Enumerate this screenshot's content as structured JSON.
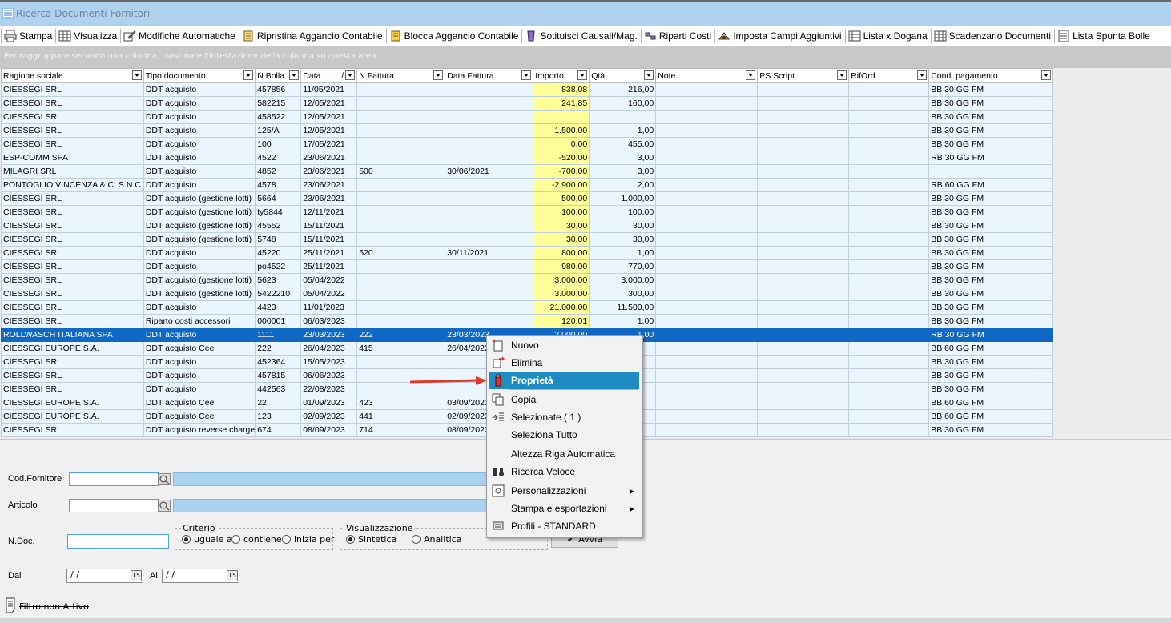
{
  "window": {
    "title": "Ricerca Documenti Fornitori"
  },
  "toolbar": [
    {
      "label": "Stampa",
      "icon": "print-icon"
    },
    {
      "label": "Visualizza",
      "icon": "grid-icon"
    },
    {
      "label": "Modifiche Automatiche",
      "icon": "edit-icon"
    },
    {
      "label": "Ripristina Aggancio Contabile",
      "icon": "restore-icon"
    },
    {
      "label": "Blocca Aggancio Contabile",
      "icon": "lock-icon"
    },
    {
      "label": "Sotituisci Causali/Mag.",
      "icon": "replace-icon"
    },
    {
      "label": "Riparti Costi",
      "icon": "split-icon"
    },
    {
      "label": "Imposta Campi Aggiuntivi",
      "icon": "settings-icon"
    },
    {
      "label": "Lista x Dogana",
      "icon": "list-icon"
    },
    {
      "label": "Scadenzario Documenti",
      "icon": "calendar-icon"
    },
    {
      "label": "Lista Spunta Bolle",
      "icon": "checklist-icon"
    }
  ],
  "group_hint": "Per raggruppare secondo una colonna, trascinare l'intestazione della colonna su questa area",
  "grid": {
    "columns": [
      "Ragione sociale",
      "Tipo documento",
      "N.Bolla",
      "Data ...",
      "N.Fattura",
      "Data Fattura",
      "Importo",
      "Qtà",
      "Note",
      "PS.Script",
      "RifOrd.",
      "Cond. pagamento"
    ],
    "sort_indicator": "/",
    "rows": [
      [
        "CIESSEGI SRL",
        "DDT acquisto",
        "457856",
        "11/05/2021",
        "",
        "",
        "838,08",
        "216,00",
        "",
        "",
        "",
        "BB 30 GG FM"
      ],
      [
        "CIESSEGI SRL",
        "DDT acquisto",
        "582215",
        "12/05/2021",
        "",
        "",
        "241,85",
        "160,00",
        "",
        "",
        "",
        "BB 30 GG FM"
      ],
      [
        "CIESSEGI SRL",
        "DDT acquisto",
        "458522",
        "12/05/2021",
        "",
        "",
        "",
        "",
        "",
        "",
        "",
        "BB 30 GG FM"
      ],
      [
        "CIESSEGI SRL",
        "DDT acquisto",
        "125/A",
        "12/05/2021",
        "",
        "",
        "1.500,00",
        "1,00",
        "",
        "",
        "",
        "BB 30 GG FM"
      ],
      [
        "CIESSEGI SRL",
        "DDT acquisto",
        "100",
        "17/05/2021",
        "",
        "",
        "0,00",
        "455,00",
        "",
        "",
        "",
        "BB 30 GG FM"
      ],
      [
        "ESP-COMM SPA",
        "DDT acquisto",
        "4522",
        "23/06/2021",
        "",
        "",
        "-520,00",
        "3,00",
        "",
        "",
        "",
        "RB 30 GG FM"
      ],
      [
        "MILAGRI SRL",
        "DDT acquisto",
        "4852",
        "23/06/2021",
        "500",
        "30/06/2021",
        "-700,00",
        "3,00",
        "",
        "",
        "",
        ""
      ],
      [
        "PONTOGLIO VINCENZA & C. S.N.C.",
        "DDT acquisto",
        "4578",
        "23/06/2021",
        "",
        "",
        "-2.900,00",
        "2,00",
        "",
        "",
        "",
        "RB 60 GG FM"
      ],
      [
        "CIESSEGI SRL",
        "DDT acquisto (gestione lotti)",
        "5664",
        "23/06/2021",
        "",
        "",
        "500,00",
        "1.000,00",
        "",
        "",
        "",
        "BB 30 GG FM"
      ],
      [
        "CIESSEGI SRL",
        "DDT acquisto (gestione lotti)",
        "ty5844",
        "12/11/2021",
        "",
        "",
        "100,00",
        "100,00",
        "",
        "",
        "",
        "BB 30 GG FM"
      ],
      [
        "CIESSEGI SRL",
        "DDT acquisto (gestione lotti)",
        "45552",
        "15/11/2021",
        "",
        "",
        "30,00",
        "30,00",
        "",
        "",
        "",
        "BB 30 GG FM"
      ],
      [
        "CIESSEGI SRL",
        "DDT acquisto (gestione lotti)",
        "5748",
        "15/11/2021",
        "",
        "",
        "30,00",
        "30,00",
        "",
        "",
        "",
        "BB 30 GG FM"
      ],
      [
        "CIESSEGI SRL",
        "DDT acquisto",
        "45220",
        "25/11/2021",
        "520",
        "30/11/2021",
        "800,00",
        "1,00",
        "",
        "",
        "",
        "BB 30 GG FM"
      ],
      [
        "CIESSEGI SRL",
        "DDT acquisto",
        "po4522",
        "25/11/2021",
        "",
        "",
        "980,00",
        "770,00",
        "",
        "",
        "",
        "BB 30 GG FM"
      ],
      [
        "CIESSEGI SRL",
        "DDT acquisto (gestione lotti)",
        "5623",
        "05/04/2022",
        "",
        "",
        "3.000,00",
        "3.000,00",
        "",
        "",
        "",
        "BB 30 GG FM"
      ],
      [
        "CIESSEGI SRL",
        "DDT acquisto (gestione lotti)",
        "5422210",
        "05/04/2022",
        "",
        "",
        "3.000,00",
        "300,00",
        "",
        "",
        "",
        "BB 30 GG FM"
      ],
      [
        "CIESSEGI SRL",
        "DDT acquisto",
        "4423",
        "11/01/2023",
        "",
        "",
        "21.000,00",
        "11.500,00",
        "",
        "",
        "",
        "BB 30 GG FM"
      ],
      [
        "CIESSEGI SRL",
        "Riparto costi accessori",
        "000001",
        "06/03/2023",
        "",
        "",
        "120,01",
        "1,00",
        "",
        "",
        "",
        "BB 30 GG FM"
      ],
      [
        "ROLLWASCH ITALIANA SPA",
        "DDT acquisto",
        "1111",
        "23/03/2023",
        "222",
        "23/03/2023",
        "2.000,00",
        "1,00",
        "",
        "",
        "",
        "RB 30 GG FM"
      ],
      [
        "CIESSEGI EUROPE S.A.",
        "DDT acquisto Cee",
        "222",
        "26/04/2023",
        "415",
        "26/04/2023",
        "",
        "",
        "",
        "",
        "",
        "BB 60 GG FM"
      ],
      [
        "CIESSEGI SRL",
        "DDT acquisto",
        "452364",
        "15/05/2023",
        "",
        "",
        "",
        "",
        "",
        "",
        "",
        "BB 30 GG FM"
      ],
      [
        "CIESSEGI SRL",
        "DDT acquisto",
        "457815",
        "06/06/2023",
        "",
        "",
        "",
        "",
        "",
        "",
        "",
        "BB 30 GG FM"
      ],
      [
        "CIESSEGI SRL",
        "DDT acquisto",
        "442563",
        "22/08/2023",
        "",
        "",
        "",
        "",
        "",
        "",
        "",
        "BB 30 GG FM"
      ],
      [
        "CIESSEGI EUROPE S.A.",
        "DDT acquisto Cee",
        "22",
        "01/09/2023",
        "423",
        "03/09/2023",
        "",
        "",
        "",
        "",
        "",
        "BB 60 GG FM"
      ],
      [
        "CIESSEGI EUROPE S.A.",
        "DDT acquisto Cee",
        "123",
        "02/09/2023",
        "441",
        "02/09/2023",
        "",
        "",
        "",
        "",
        "",
        "BB 60 GG FM"
      ],
      [
        "CIESSEGI SRL",
        "DDT acquisto reverse charge",
        "674",
        "08/09/2023",
        "714",
        "08/09/2023",
        "",
        "",
        "",
        "",
        "",
        "BB 30 GG FM"
      ]
    ],
    "selected_row": 18
  },
  "filter": {
    "cod_fornitore_label": "Cod.Fornitore",
    "articolo_label": "Articolo",
    "ndoc_label": "N.Doc.",
    "criterio": {
      "title": "Criterio",
      "options": [
        "uguale a",
        "contiene",
        "inizia per"
      ],
      "selected": 0
    },
    "visualizzazione": {
      "title": "Visualizzazione",
      "options": [
        "Sintetica",
        "Analitica"
      ],
      "selected": 0
    },
    "avvia_label": "Avvia",
    "dal_label": "Dal",
    "al_label": "Al",
    "dal_value": "/ /",
    "al_value": "/ /"
  },
  "status": {
    "text": "Filtro non Attivo"
  },
  "context_menu": {
    "items": [
      {
        "label": "Nuovo",
        "icon": "new-icon"
      },
      {
        "label": "Elimina",
        "icon": "delete-icon"
      },
      {
        "label": "Proprietà",
        "icon": "properties-icon",
        "highlighted": true
      },
      {
        "label": "Copia",
        "icon": "copy-icon"
      },
      {
        "label": "Selezionate ( 1 )",
        "icon": "selected-list-icon"
      },
      {
        "label": "Seleziona Tutto",
        "icon": ""
      },
      {
        "label": "Altezza Riga Automatica",
        "icon": ""
      },
      {
        "label": "Ricerca Veloce",
        "icon": "binoculars-icon"
      },
      {
        "label": "Personalizzazioni",
        "icon": "customize-icon",
        "submenu": true
      },
      {
        "label": "Stampa e esportazioni",
        "icon": "",
        "submenu": true
      },
      {
        "label": "Profili - STANDARD",
        "icon": "profile-icon"
      }
    ]
  },
  "colors": {
    "titlebar": "#afd3ef",
    "selection": "#0f68c4",
    "importo_cell": "#ffff99",
    "menu_highlight": "#1e8bc3",
    "arrow": "#e03a2a"
  }
}
